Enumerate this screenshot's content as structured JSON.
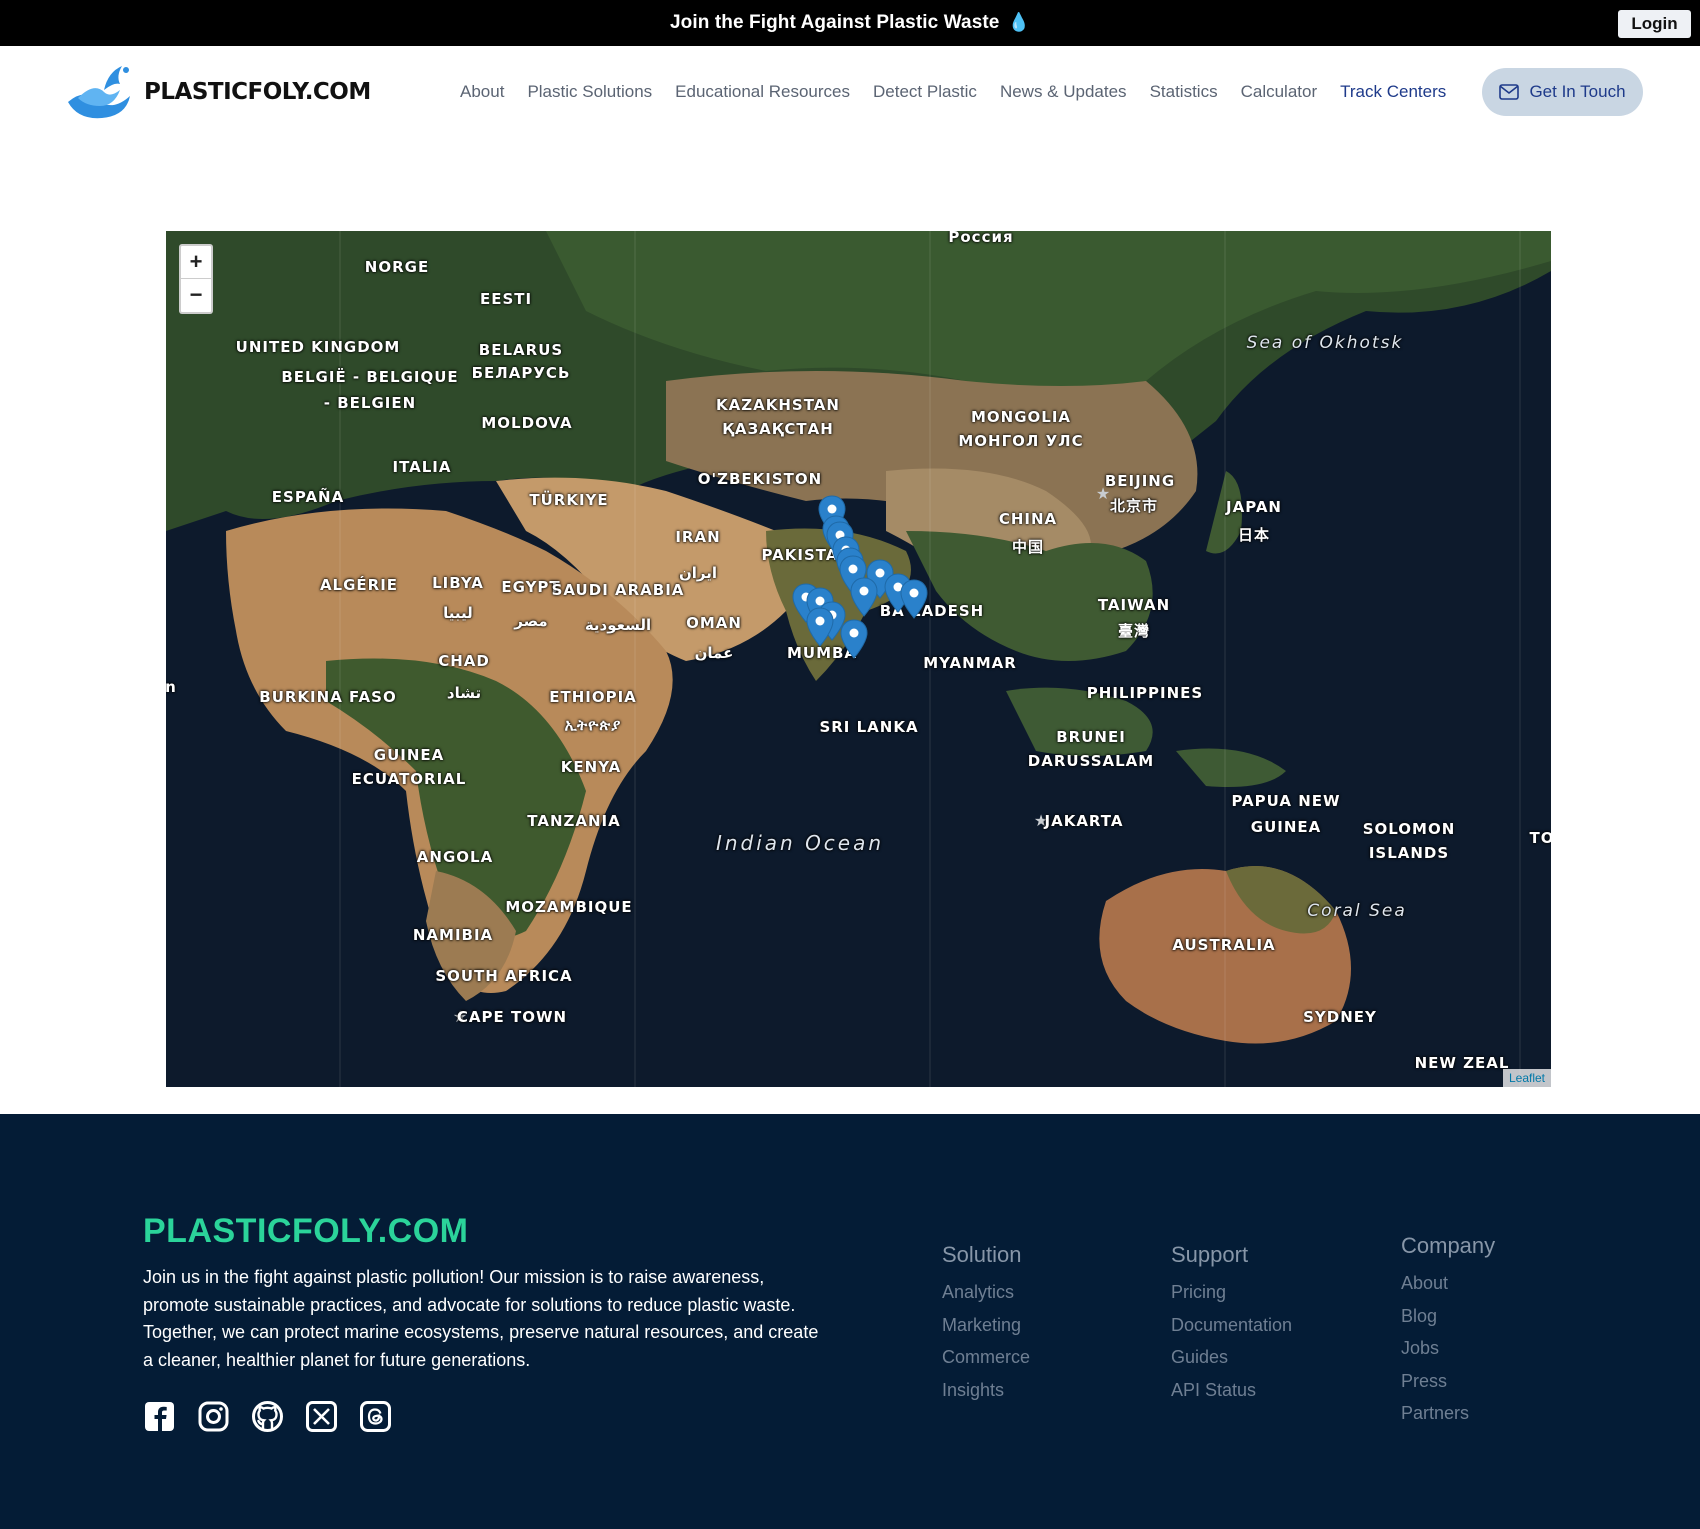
{
  "announcement": {
    "text": "Join the Fight Against Plastic Waste",
    "icon": "droplet-icon",
    "login_label": "Login"
  },
  "header": {
    "logo_text": "PLASTICFOLY.COM",
    "nav": [
      "About",
      "Plastic Solutions",
      "Educational Resources",
      "Detect Plastic",
      "News & Updates",
      "Statistics",
      "Calculator",
      "Track Centers"
    ],
    "active_nav": "Track Centers",
    "cta_label": "Get In Touch",
    "cta_icon": "mail-icon"
  },
  "map": {
    "zoom_in": "+",
    "zoom_out": "−",
    "attribution": "Leaflet",
    "labels": {
      "norge": "NORGE",
      "eesti": "EESTI",
      "uk": "UNITED KINGDOM",
      "belarus": "BELARUS",
      "belarus2": "БЕЛАРУСЬ",
      "belgie1": "BELGIË - BELGIQUE",
      "belgie2": "- BELGIEN",
      "moldova": "MOLDOVA",
      "italia": "ITALIA",
      "espana": "ESPAÑA",
      "turkiye": "TÜRKIYE",
      "kazakhstan1": "KAZAKHSTAN",
      "kazakhstan2": "ҚАЗАҚСТАН",
      "mongolia1": "MONGOLIA",
      "mongolia2": "МОНГОЛ УЛС",
      "uzbekiston": "O'ZBEKISTON",
      "beijing1": "BEIJING",
      "beijing2": "北京市",
      "japan1": "JAPAN",
      "japan2": "日本",
      "sea_okhotsk": "Sea of Okhotsk",
      "china1": "CHINA",
      "china2": "中国",
      "iran1": "IRAN",
      "iran2": "ایران",
      "pakistan": "PAKISTA",
      "algerie": "ALGÉRIE",
      "libya1": "LIBYA",
      "libya2": "ليبيا",
      "egypt1": "EGYPT",
      "egypt2": "مصر",
      "saudi1": "SAUDI ARABIA",
      "saudi2": "السعودية",
      "oman1": "OMAN",
      "oman2": "عمان",
      "bangladesh": "BA  LADESH",
      "taiwan1": "TAIWAN",
      "taiwan2": "臺灣",
      "mumbai": "MUMBA",
      "myanmar": "MYANMAR",
      "chad1": "CHAD",
      "chad2": "تشاد",
      "burkina": "BURKINA FASO",
      "ethiopia1": "ETHIOPIA",
      "ethiopia2": "ኢትዮጵያ",
      "philippines": "PHILIPPINES",
      "srilanka": "SRI LANKA",
      "brunei1": "BRUNEI",
      "brunei2": "DARUSSALAM",
      "guinea1": "GUINEA",
      "guinea2": "ECUATORIAL",
      "kenya": "KENYA",
      "jakarta": "JAKARTA",
      "papua1": "PAPUA NEW",
      "papua2": "GUINEA",
      "solomon1": "SOLOMON",
      "solomon2": "ISLANDS",
      "tanzania": "TANZANIA",
      "indian_ocean": "Indian Ocean",
      "angola": "ANGOLA",
      "mozambique": "MOZAMBIQUE",
      "coral_sea": "Coral Sea",
      "namibia": "NAMIBIA",
      "australia": "AUSTRALIA",
      "south_africa": "SOUTH AFRICA",
      "cape_town": "CAPE TOWN",
      "sydney": "SYDNEY",
      "new_zealand": "NEW ZEAL",
      "rossiya": "Россия",
      "edge_n": "n",
      "edge_to": "TO"
    }
  },
  "footer": {
    "brand": "PLASTICFOLY.COM",
    "description": "Join us in the fight against plastic pollution! Our mission is to raise awareness, promote sustainable practices, and advocate for solutions to reduce plastic waste. Together, we can protect marine ecosystems, preserve natural resources, and create a cleaner, healthier planet for future generations.",
    "socials": [
      "facebook-icon",
      "instagram-icon",
      "github-icon",
      "x-icon",
      "threads-icon"
    ],
    "columns": [
      {
        "title": "Solution",
        "links": [
          "Analytics",
          "Marketing",
          "Commerce",
          "Insights"
        ]
      },
      {
        "title": "Support",
        "links": [
          "Pricing",
          "Documentation",
          "Guides",
          "API Status"
        ]
      },
      {
        "title": "Company",
        "links": [
          "About",
          "Blog",
          "Jobs",
          "Press",
          "Partners"
        ]
      }
    ]
  }
}
